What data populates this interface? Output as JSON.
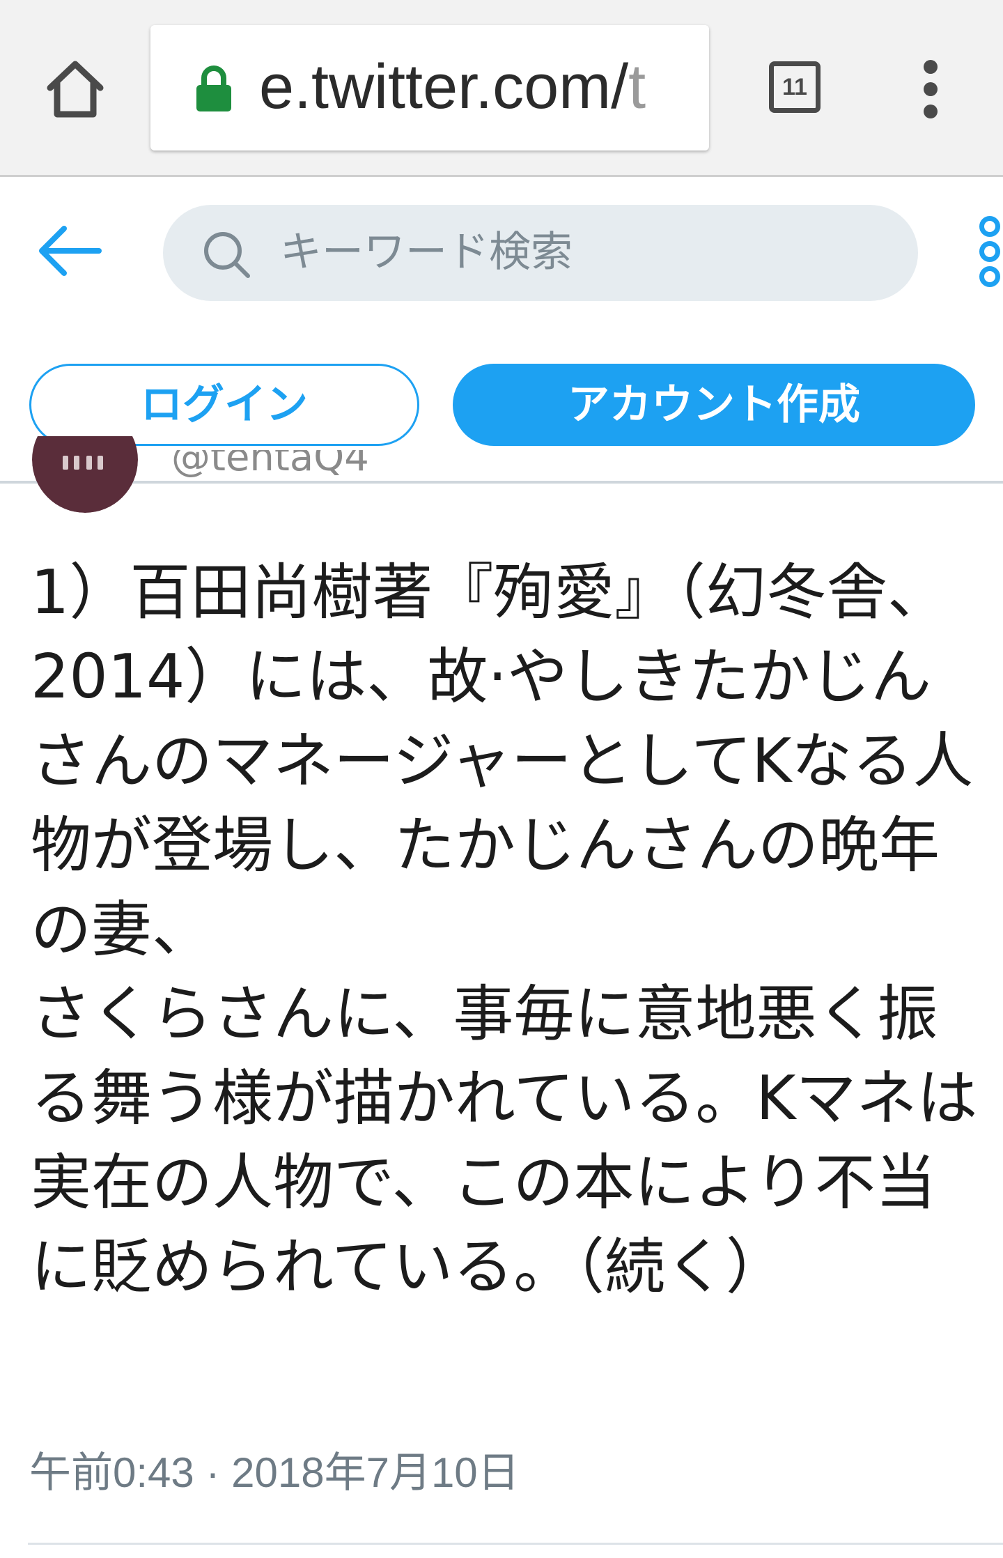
{
  "browser": {
    "url_main": "e.twitter.com/",
    "url_cut": "t",
    "tab_count": "11"
  },
  "header": {
    "search_placeholder": "キーワード検索",
    "login_label": "ログイン",
    "signup_label": "アカウント作成",
    "accent_color": "#1da1f2"
  },
  "tweet": {
    "handle": "@tentaQ4",
    "text": "1）百田尚樹著『殉愛』（幻冬舎、2014）には、故·やしきたかじんさんのマネージャーとしてKなる人物が登場し、たかじんさんの晩年の妻、\nさくらさんに、事毎に意地悪く振る舞う様が描かれている。Kマネは実在の人物で、この本により不当に貶められている。（続く）",
    "timestamp": "午前0:43 · 2018年7月10日"
  }
}
